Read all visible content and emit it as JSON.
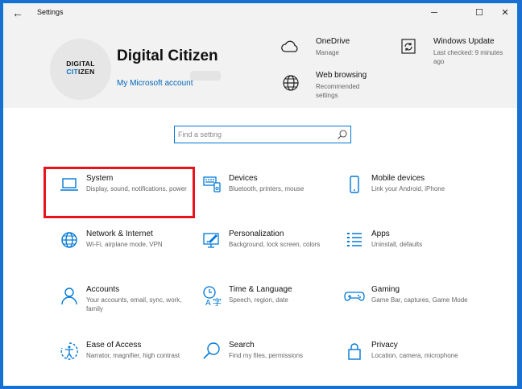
{
  "titlebar": {
    "title": "Settings",
    "back_glyph": "←",
    "minimize_glyph": "─",
    "maximize_glyph": "☐",
    "close_glyph": "✕"
  },
  "account": {
    "avatar_line1": "DIGITAL",
    "avatar_line2_blue": "CIT",
    "avatar_line2_rest": "IZEN",
    "name": "Digital Citizen",
    "link": "My Microsoft account"
  },
  "header_items": {
    "onedrive": {
      "title": "OneDrive",
      "sub": "Manage",
      "icon": "cloud-icon"
    },
    "windows_update": {
      "title": "Windows Update",
      "sub": "Last checked: 9 minutes ago",
      "icon": "update-icon"
    },
    "web_browsing": {
      "title": "Web browsing",
      "sub": "Recommended settings",
      "icon": "globe-icon"
    }
  },
  "search": {
    "placeholder": "Find a setting",
    "value": ""
  },
  "tiles": [
    {
      "name": "System",
      "desc": "Display, sound, notifications, power",
      "icon": "laptop-icon"
    },
    {
      "name": "Devices",
      "desc": "Bluetooth, printers, mouse",
      "icon": "devices-icon"
    },
    {
      "name": "Mobile devices",
      "desc": "Link your Android, iPhone",
      "icon": "phone-icon"
    },
    {
      "name": "Network & Internet",
      "desc": "Wi-Fi, airplane mode, VPN",
      "icon": "globe-icon"
    },
    {
      "name": "Personalization",
      "desc": "Background, lock screen, colors",
      "icon": "paint-icon"
    },
    {
      "name": "Apps",
      "desc": "Uninstall, defaults",
      "icon": "apps-list-icon"
    },
    {
      "name": "Accounts",
      "desc": "Your accounts, email, sync, work, family",
      "icon": "person-icon"
    },
    {
      "name": "Time & Language",
      "desc": "Speech, region, date",
      "icon": "time-language-icon"
    },
    {
      "name": "Gaming",
      "desc": "Game Bar, captures, Game Mode",
      "icon": "gamepad-icon"
    },
    {
      "name": "Ease of Access",
      "desc": "Narrator, magnifier, high contrast",
      "icon": "ease-of-access-icon"
    },
    {
      "name": "Search",
      "desc": "Find my files, permissions",
      "icon": "search-icon"
    },
    {
      "name": "Privacy",
      "desc": "Location, camera, microphone",
      "icon": "lock-icon"
    }
  ],
  "colors": {
    "accent": "#0078d7",
    "highlight": "#e8131b",
    "header_bg": "#f2f2f2"
  }
}
